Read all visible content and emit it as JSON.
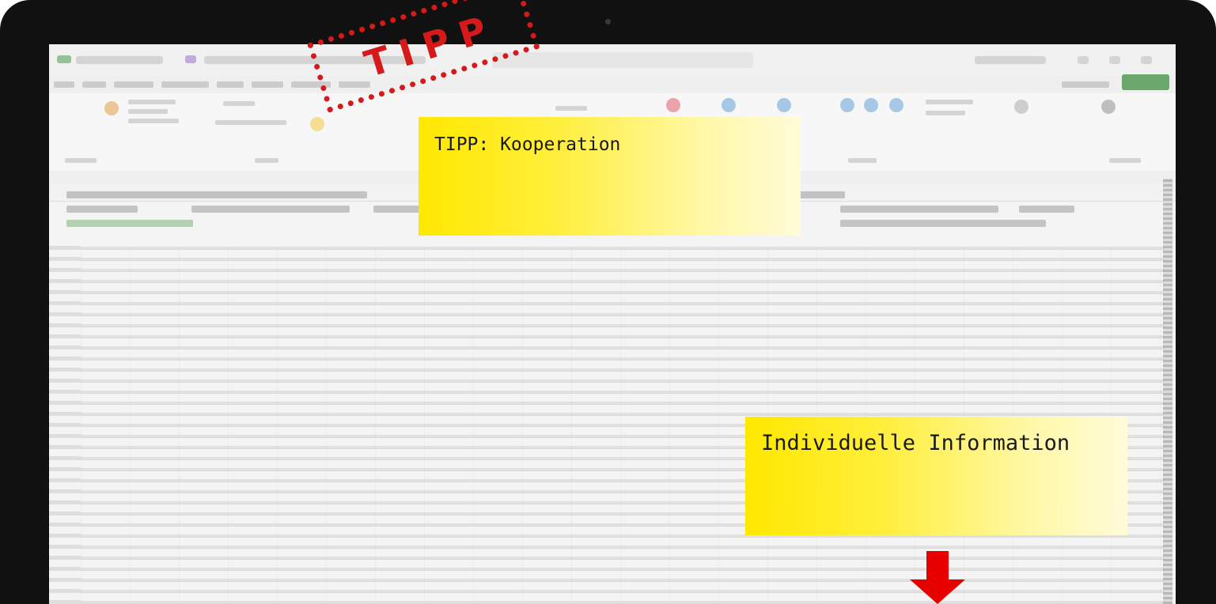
{
  "screen": {
    "app": "spreadsheet-window",
    "icons": [
      "excel-app-icon",
      "share-icon"
    ]
  },
  "annotations": {
    "stamp_text": "TIPP",
    "note_1": "TIPP: Kooperation",
    "note_2": "Individuelle Information",
    "arrow_icon": "down-arrow-icon"
  },
  "colors": {
    "note_yellow": "#ffe800",
    "stamp_red": "#d61a1a",
    "arrow_red": "#e60000",
    "share_green": "#6ba86b"
  }
}
